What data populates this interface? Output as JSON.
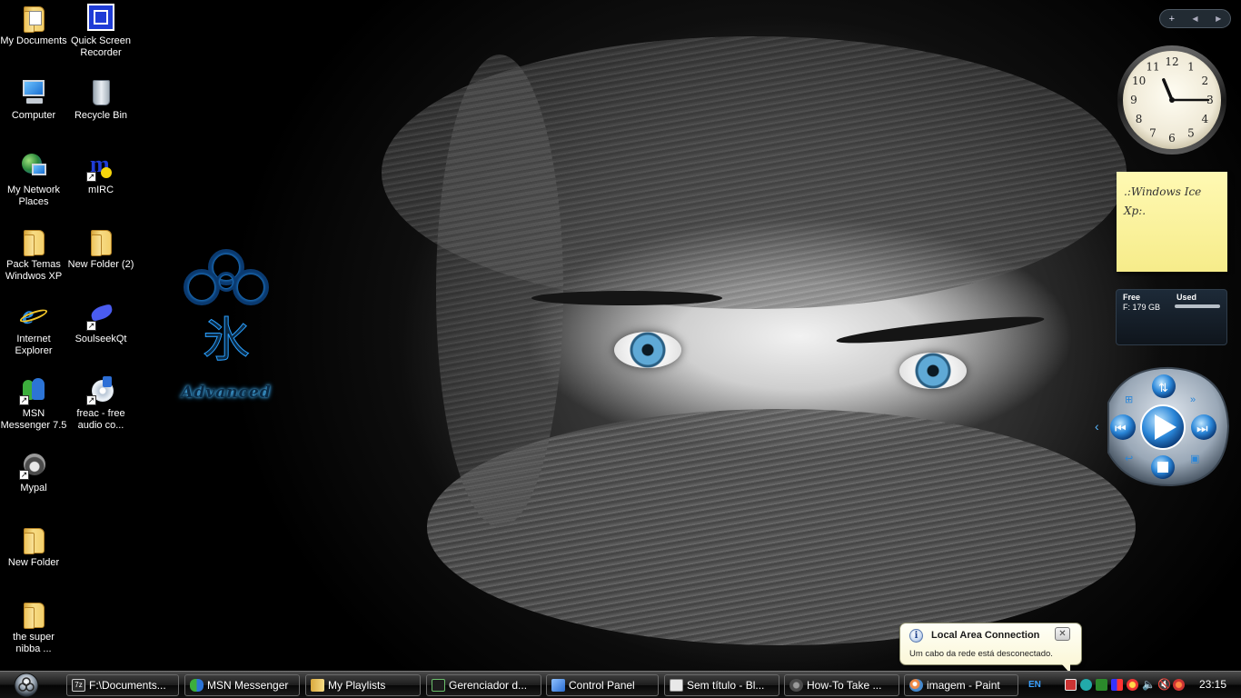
{
  "desktop": {
    "icons": [
      {
        "label": "My Documents",
        "icon": "my-documents-icon"
      },
      {
        "label": "Quick Screen Recorder",
        "icon": "screen-recorder-icon"
      },
      {
        "label": "Computer",
        "icon": "computer-icon"
      },
      {
        "label": "Recycle Bin",
        "icon": "recycle-bin-icon"
      },
      {
        "label": "My Network Places",
        "icon": "network-places-icon"
      },
      {
        "label": "mIRC",
        "icon": "mirc-icon"
      },
      {
        "label": "Pack Temas Windwos XP",
        "icon": "folder-icon"
      },
      {
        "label": "New Folder (2)",
        "icon": "folder-icon"
      },
      {
        "label": "Internet Explorer",
        "icon": "internet-explorer-icon"
      },
      {
        "label": "SoulseekQt",
        "icon": "soulseek-icon"
      },
      {
        "label": "MSN Messenger 7.5",
        "icon": "msn-messenger-icon"
      },
      {
        "label": "freac - free audio co...",
        "icon": "freac-icon"
      },
      {
        "label": "Mypal",
        "icon": "mypal-icon"
      },
      {
        "label": "New Folder",
        "icon": "folder-icon"
      },
      {
        "label": "the super nibba ...",
        "icon": "folder-icon"
      }
    ]
  },
  "logo": {
    "glyph": "氷",
    "text": "Advanced"
  },
  "sidebar": {
    "controls": {
      "add": "+",
      "prev": "◀",
      "next": "▶"
    },
    "clock": {
      "hour": 11,
      "minute": 15,
      "numbers": [
        "12",
        "1",
        "2",
        "3",
        "4",
        "5",
        "6",
        "7",
        "8",
        "9",
        "10",
        "11"
      ]
    },
    "note": {
      "text": ".:Windows Ice Xp:."
    },
    "drive": {
      "free_label": "Free",
      "used_label": "Used",
      "value": "F: 179 GB",
      "used_fraction": 0.0
    }
  },
  "balloon": {
    "title": "Local Area Connection",
    "body": "Um cabo da rede está desconectado.",
    "close": "✕",
    "info": "i"
  },
  "taskbar": {
    "tasks": [
      {
        "label": "F:\\Documents...",
        "color": "#2c2c2c"
      },
      {
        "label": "MSN Messenger",
        "color": "#3b7bd8"
      },
      {
        "label": "My Playlists",
        "color": "#e9c25a"
      },
      {
        "label": "Gerenciador d...",
        "color": "#4a9a4a"
      },
      {
        "label": "Control Panel",
        "color": "#4d86d1"
      },
      {
        "label": "Sem título - Bl...",
        "color": "#cfcfcf"
      },
      {
        "label": "How-To Take ...",
        "color": "#6a6a6a"
      },
      {
        "label": "imagem - Paint",
        "color": "#d98a3c"
      }
    ],
    "language": "EN",
    "time": "23:15"
  }
}
